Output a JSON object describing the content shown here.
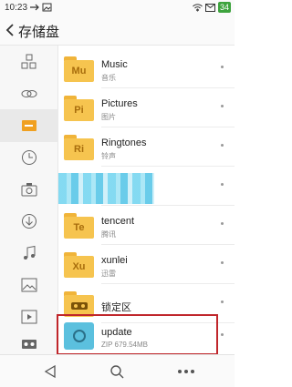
{
  "status_bar": {
    "time": "10:23",
    "battery": "34",
    "icons": [
      "usb-icon",
      "image-icon",
      "wifi-icon",
      "mail-icon",
      "battery-icon"
    ]
  },
  "header": {
    "title": "存储盘",
    "back_icon": "chevron-left-icon"
  },
  "sidebar": {
    "items": [
      {
        "icon": "category-icon"
      },
      {
        "icon": "link-icon"
      },
      {
        "icon": "storage-folder-icon",
        "active": true
      },
      {
        "icon": "clock-icon"
      },
      {
        "icon": "camera-icon"
      },
      {
        "icon": "download-icon"
      },
      {
        "icon": "music-note-icon"
      },
      {
        "icon": "picture-icon"
      },
      {
        "icon": "video-icon"
      },
      {
        "icon": "vr-glasses-icon"
      }
    ]
  },
  "files": [
    {
      "badge": "Mu",
      "name": "Music",
      "subtitle": "音乐"
    },
    {
      "badge": "Pi",
      "name": "Pictures",
      "subtitle": "图片"
    },
    {
      "badge": "Ri",
      "name": "Ringtones",
      "subtitle": "铃声"
    },
    {
      "badge": "",
      "name": "",
      "subtitle": ""
    },
    {
      "badge": "Te",
      "name": "tencent",
      "subtitle": "腾讯"
    },
    {
      "badge": "Xu",
      "name": "xunlei",
      "subtitle": "迅雷"
    },
    {
      "badge": "",
      "name": "锁定区",
      "subtitle": ""
    },
    {
      "name": "update",
      "subtitle": "ZIP 679.54MB"
    }
  ],
  "colors": {
    "folder": "#f6c44f",
    "highlight": "#c0262b",
    "app_icon": "#5bc0de"
  },
  "bottom_nav": {
    "icons": [
      "back-triangle-icon",
      "search-icon",
      "more-dots-icon"
    ]
  }
}
